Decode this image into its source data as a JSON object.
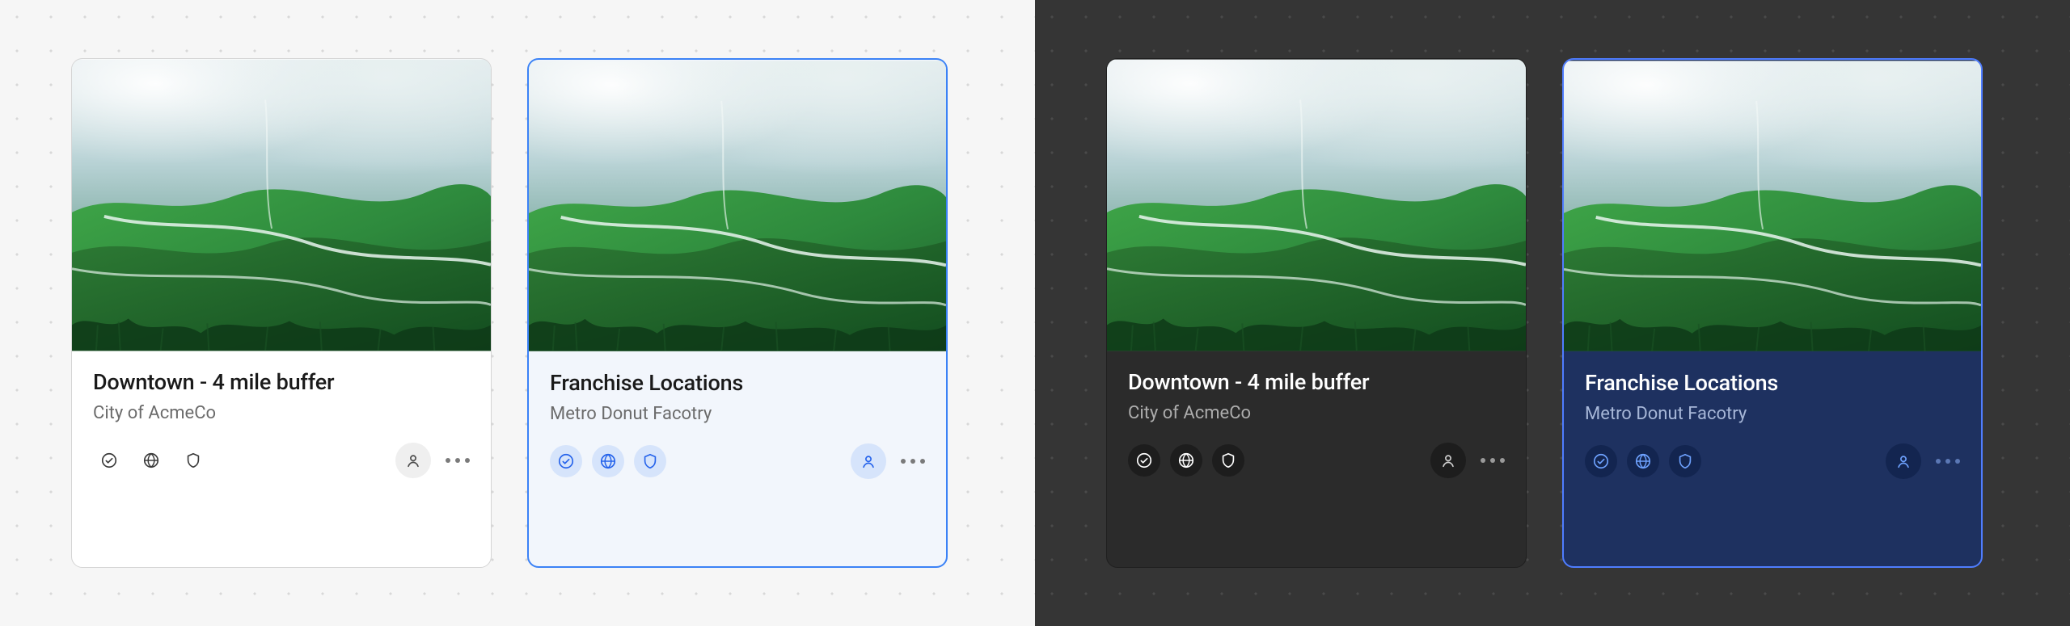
{
  "panels": [
    {
      "theme": "light"
    },
    {
      "theme": "dark"
    }
  ],
  "cards": [
    {
      "title": "Downtown - 4 mile buffer",
      "subtitle": "City of AcmeCo",
      "selected": false,
      "icons": [
        "check",
        "globe",
        "shield"
      ]
    },
    {
      "title": "Franchise Locations",
      "subtitle": "Metro Donut Facotry",
      "selected": true,
      "icons": [
        "check",
        "globe",
        "shield"
      ]
    }
  ]
}
